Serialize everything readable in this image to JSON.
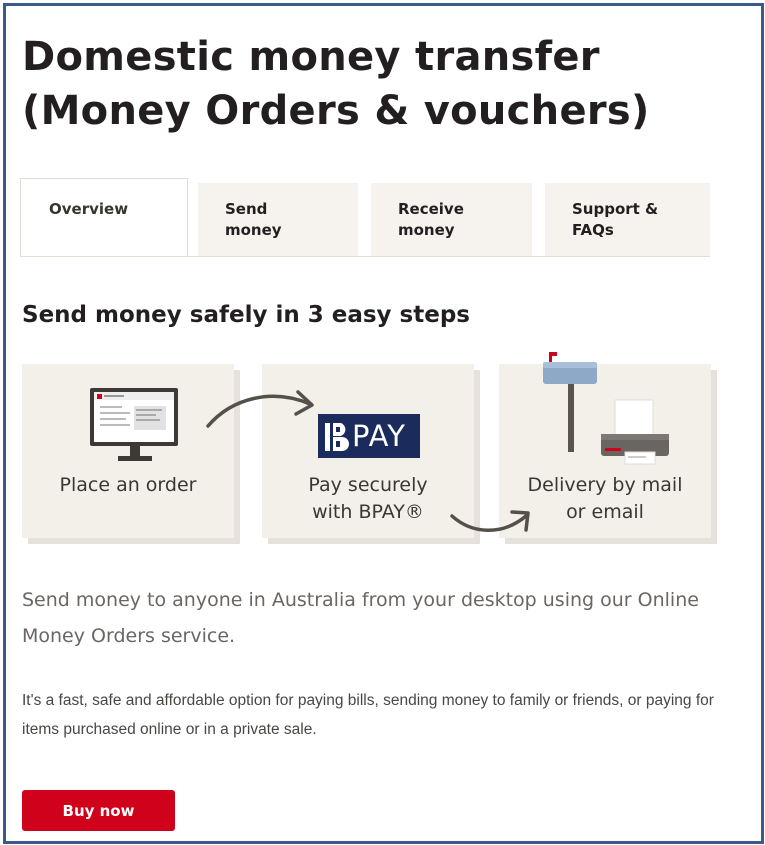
{
  "page": {
    "title_line1": "Domestic money transfer",
    "title_line2": "(Money Orders & vouchers)"
  },
  "tabs": [
    {
      "label_line1": "Overview",
      "label_line2": ""
    },
    {
      "label_line1": "Send",
      "label_line2": "money"
    },
    {
      "label_line1": "Receive",
      "label_line2": "money"
    },
    {
      "label_line1": "Support &",
      "label_line2": "FAQs"
    }
  ],
  "steps": {
    "title": "Send money safely in 3 easy steps",
    "items": [
      {
        "line1": "Place an order",
        "line2": "",
        "icon": "computer-monitor-icon"
      },
      {
        "line1": "Pay securely",
        "line2": "with BPAY®",
        "icon": "bpay-logo"
      },
      {
        "line1": "Delivery by mail",
        "line2": "or email",
        "icon": "mailbox-printer-icon"
      }
    ],
    "bpay_logo_text": "PAY"
  },
  "content": {
    "intro": "Send money to anyone in Australia from your desktop using our Online Money Orders service.",
    "description": "It's a fast, safe and affordable option for paying bills, sending money to family or friends, or paying for items purchased online or in a private sale."
  },
  "cta": {
    "buy_label": "Buy now"
  },
  "colors": {
    "brand_red": "#d0021b",
    "tab_bg": "#f6f3ee",
    "card_bg": "#f3f0ea",
    "frame_border": "#3a5a8c",
    "bpay_navy": "#1a2b5c"
  }
}
